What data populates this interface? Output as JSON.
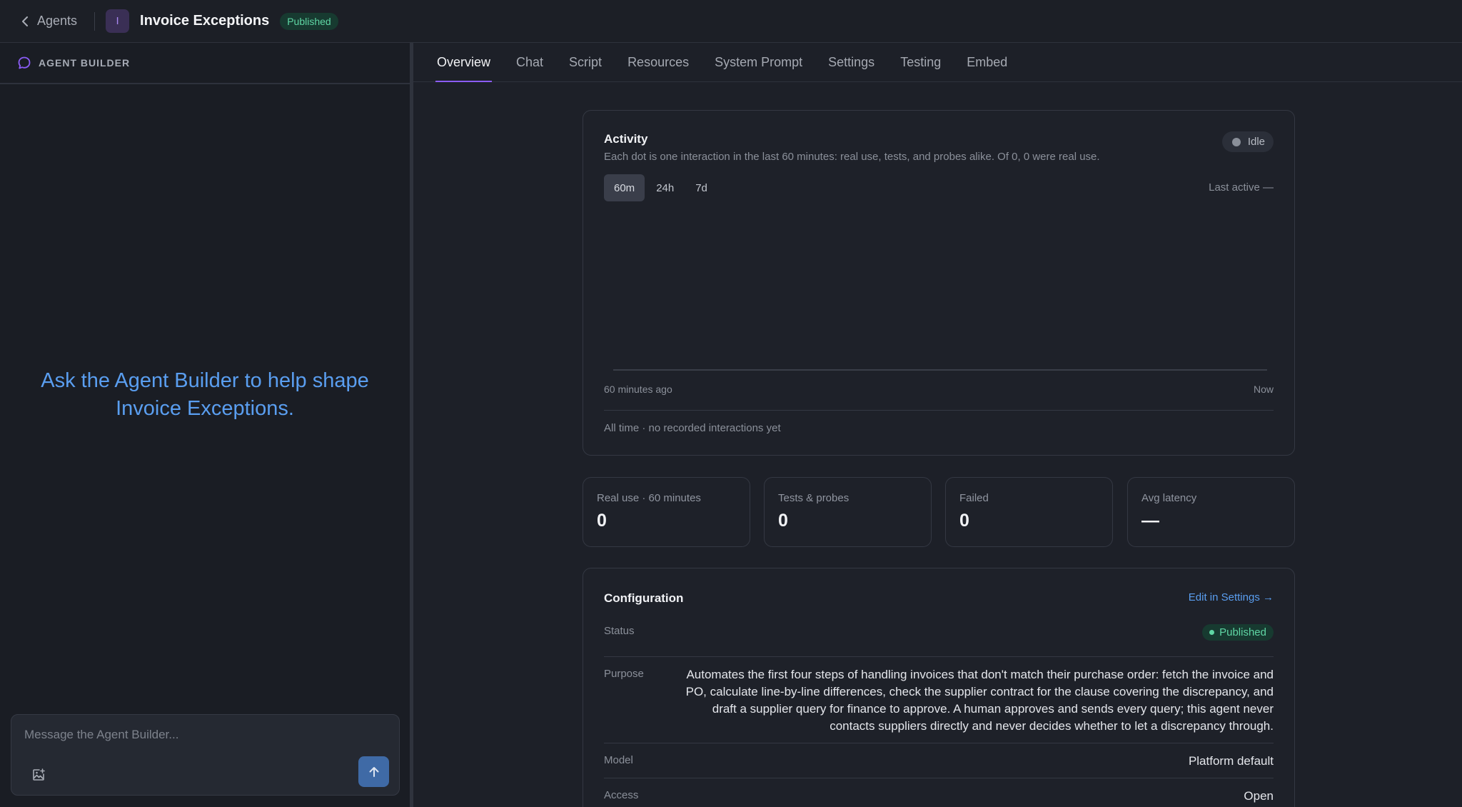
{
  "header": {
    "back_label": "Agents",
    "avatar_letter": "I",
    "title": "Invoice Exceptions",
    "status": "Published"
  },
  "builder": {
    "header_label": "AGENT BUILDER",
    "prompt_line1": "Ask the Agent Builder to help shape",
    "prompt_line2": "Invoice Exceptions.",
    "input_placeholder": "Message the Agent Builder..."
  },
  "tabs": [
    {
      "label": "Overview",
      "active": true
    },
    {
      "label": "Chat"
    },
    {
      "label": "Script"
    },
    {
      "label": "Resources"
    },
    {
      "label": "System Prompt"
    },
    {
      "label": "Settings"
    },
    {
      "label": "Testing"
    },
    {
      "label": "Embed"
    }
  ],
  "activity": {
    "title": "Activity",
    "subtitle": "Each dot is one interaction in the last 60 minutes: real use, tests, and probes alike. Of 0, 0 were real use.",
    "state": "Idle",
    "ranges": [
      "60m",
      "24h",
      "7d"
    ],
    "selected_range": "60m",
    "last_active": "Last active —",
    "axis_start": "60 minutes ago",
    "axis_end": "Now",
    "all_time": "All time · no recorded interactions yet"
  },
  "stats": [
    {
      "label": "Real use · 60 minutes",
      "value": "0"
    },
    {
      "label": "Tests & probes",
      "value": "0"
    },
    {
      "label": "Failed",
      "value": "0"
    },
    {
      "label": "Avg latency",
      "value": "—"
    }
  ],
  "config": {
    "title": "Configuration",
    "edit_label": "Edit in Settings →",
    "status_label": "Status",
    "status_value": "Published",
    "purpose_label": "Purpose",
    "purpose_value": "Automates the first four steps of handling invoices that don't match their purchase order: fetch the invoice and PO, calculate line-by-line differences, check the supplier contract for the clause covering the discrepancy, and draft a supplier query for finance to approve. A human approves and sends every query; this agent never contacts suppliers directly and never decides whether to let a discrepancy through.",
    "model_label": "Model",
    "model_value": "Platform default",
    "access_label": "Access",
    "access_value": "Open"
  },
  "colors": {
    "accent": "#8b5cf6",
    "link": "#5a9ef0",
    "success": "#5fd6a4",
    "background": "#1d2028"
  },
  "icons": {
    "back": "chevron-left-icon",
    "builder": "chat-bubble-icon",
    "attach": "image-add-icon",
    "send": "arrow-up-icon"
  }
}
